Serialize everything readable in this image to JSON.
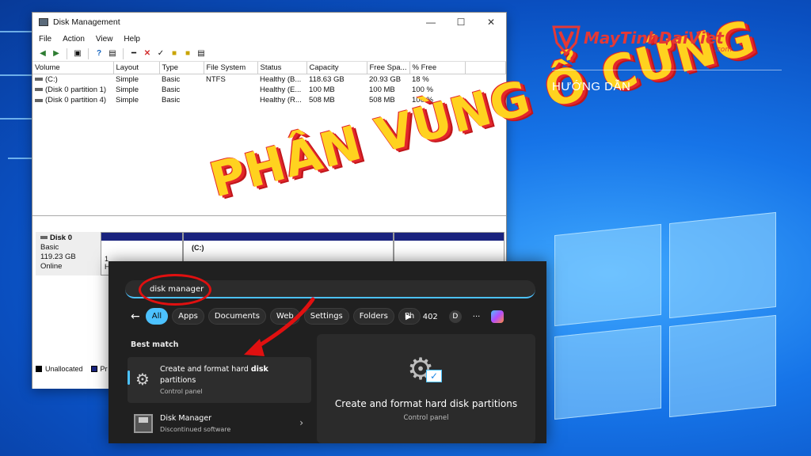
{
  "brand": {
    "name": "MayTinhDaiViet",
    "domain": ".com",
    "category": "HƯỚNG DẪN",
    "color": "#e53935"
  },
  "headline": "PHÂN VÙNG Ổ CỨNG",
  "disk_management": {
    "title": "Disk Management",
    "menu": [
      "File",
      "Action",
      "View",
      "Help"
    ],
    "columns": [
      "Volume",
      "Layout",
      "Type",
      "File System",
      "Status",
      "Capacity",
      "Free Spa...",
      "% Free"
    ],
    "rows": [
      [
        "(C:)",
        "Simple",
        "Basic",
        "NTFS",
        "Healthy (B...",
        "118.63 GB",
        "20.93 GB",
        "18 %"
      ],
      [
        "(Disk 0 partition 1)",
        "Simple",
        "Basic",
        "",
        "Healthy (E...",
        "100 MB",
        "100 MB",
        "100 %"
      ],
      [
        "(Disk 0 partition 4)",
        "Simple",
        "Basic",
        "",
        "Healthy (R...",
        "508 MB",
        "508 MB",
        "100 %"
      ]
    ],
    "disk": {
      "name": "Disk 0",
      "type": "Basic",
      "size": "119.23 GB",
      "state": "Online"
    },
    "partition_c": "(C:)",
    "partition_frag_1": "1",
    "partition_frag_2": "H",
    "legend": [
      {
        "label": "Unallocated",
        "color": "#000000"
      },
      {
        "label": "Pr",
        "color": "#1a237e"
      }
    ]
  },
  "search": {
    "query": "disk manager",
    "back_icon": "back-arrow-icon",
    "filters": [
      "All",
      "Apps",
      "Documents",
      "Web",
      "Settings",
      "Folders",
      "Ph"
    ],
    "active_filter": "All",
    "play_icon": "play-icon",
    "points": "402",
    "account_initial": "D",
    "more": "···",
    "best_match_heading": "Best match",
    "best_match": {
      "title_pre": "Create and format hard ",
      "title_bold": "disk",
      "title_post": "partitions",
      "subtitle": "Control panel",
      "icon": "gear-icon"
    },
    "second_result": {
      "title": "Disk Manager",
      "subtitle": "Discontinued software",
      "icon": "floppy-disk-icon"
    },
    "preview": {
      "title": "Create and format hard disk partitions",
      "subtitle": "Control panel"
    },
    "accent": "#4cc2ff"
  }
}
